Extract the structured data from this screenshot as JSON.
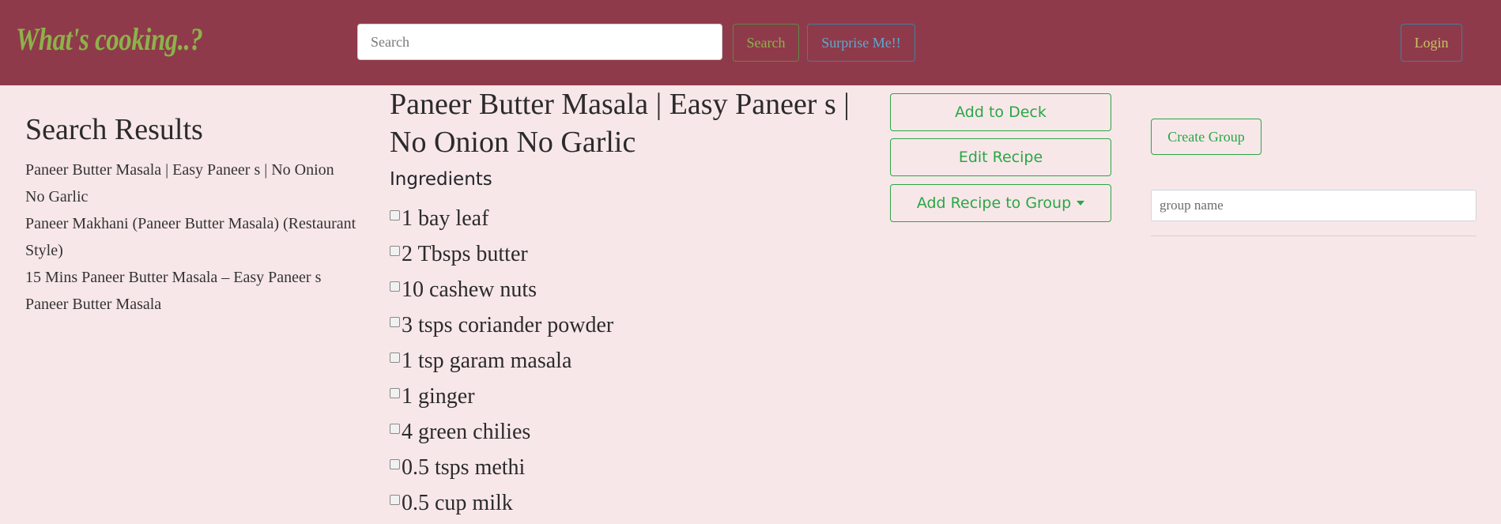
{
  "navbar": {
    "brand": "What's cooking..?",
    "search_placeholder": "Search",
    "search_button": "Search",
    "surprise_button": "Surprise Me!!",
    "login_button": "Login"
  },
  "results": {
    "title": "Search Results",
    "items": [
      "Paneer Butter Masala | Easy Paneer s | No Onion No Garlic",
      "Paneer Makhani (Paneer Butter Masala) (Restaurant Style)",
      "15 Mins Paneer Butter Masala – Easy Paneer s",
      "Paneer Butter Masala"
    ]
  },
  "recipe": {
    "title": "Paneer Butter Masala | Easy Paneer s | No Onion No Garlic",
    "ingredients_heading": "Ingredients",
    "ingredients": [
      "1 bay leaf",
      "2 Tbsps butter",
      "10 cashew nuts",
      "3 tsps coriander powder",
      "1 tsp garam masala",
      "1 ginger",
      "4 green chilies",
      "0.5 tsps methi",
      "0.5 cup milk"
    ]
  },
  "actions": {
    "add_to_deck": "Add to Deck",
    "edit_recipe": "Edit Recipe",
    "add_to_group": "Add Recipe to Group"
  },
  "groups": {
    "create_button": "Create Group",
    "name_placeholder": "group name"
  },
  "colors": {
    "navbar_bg": "#8f3a4a",
    "page_bg": "#f8e7e9",
    "brand": "#8cb24a",
    "success": "#28a745"
  }
}
